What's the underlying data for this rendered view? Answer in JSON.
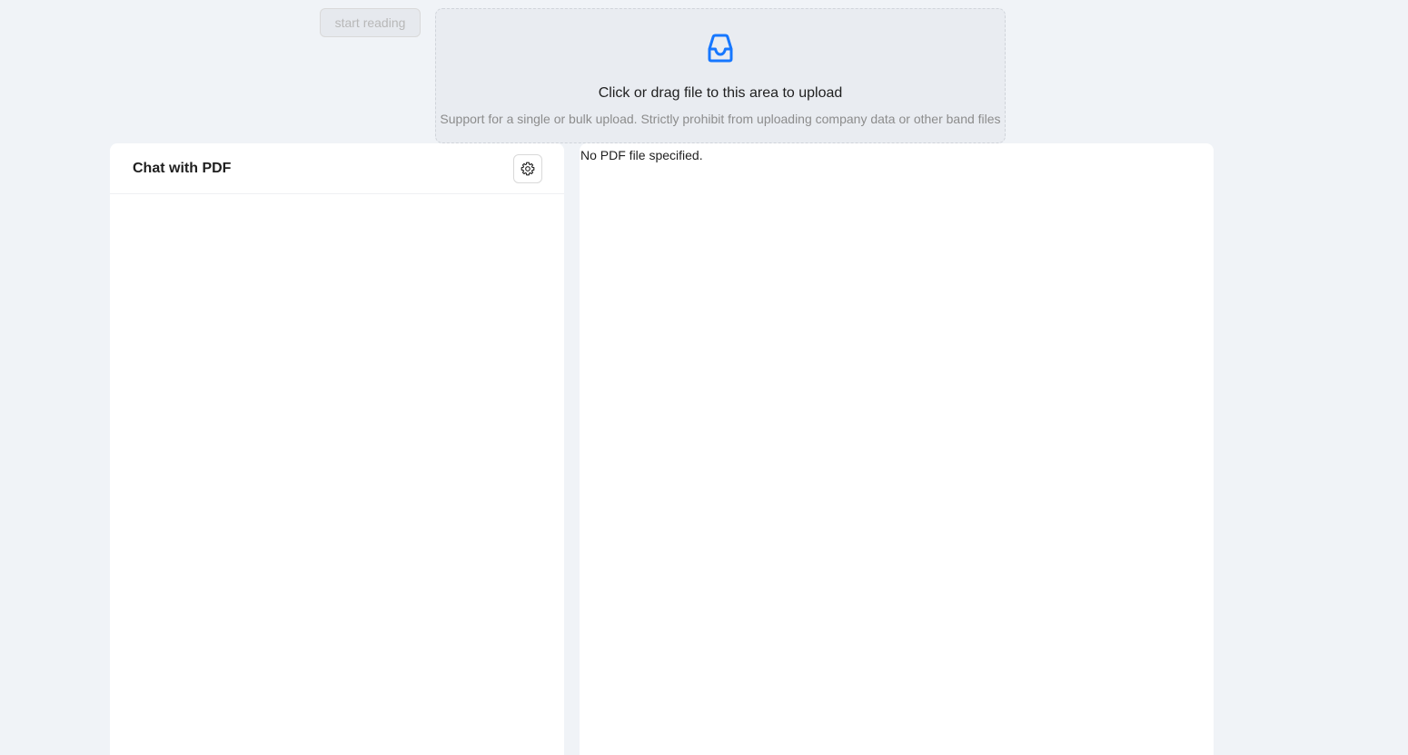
{
  "toolbar": {
    "start_label": "start reading"
  },
  "upload": {
    "icon": "inbox-icon",
    "title": "Click or drag file to this area to upload",
    "hint": "Support for a single or bulk upload. Strictly prohibit from uploading company data or other band files",
    "accent_color": "#1677ff"
  },
  "chat": {
    "title": "Chat with PDF",
    "settings_icon": "gear-icon"
  },
  "viewer": {
    "empty_message": "No PDF file specified."
  }
}
